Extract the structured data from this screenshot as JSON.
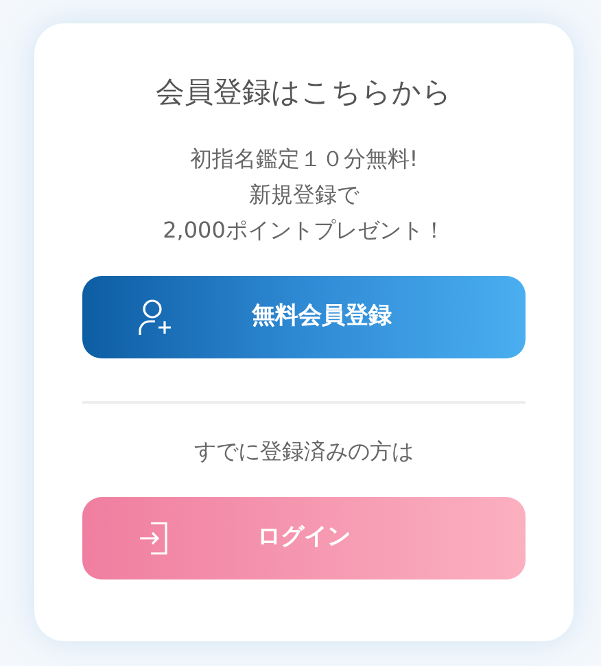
{
  "heading": "会員登録はこちらから",
  "promo_lines": [
    "初指名鑑定１０分無料!",
    "新規登録で",
    "2,000ポイントプレゼント！"
  ],
  "register_button": {
    "label": "無料会員登録"
  },
  "login_prompt": "すでに登録済みの方は",
  "login_button": {
    "label": "ログイン"
  }
}
